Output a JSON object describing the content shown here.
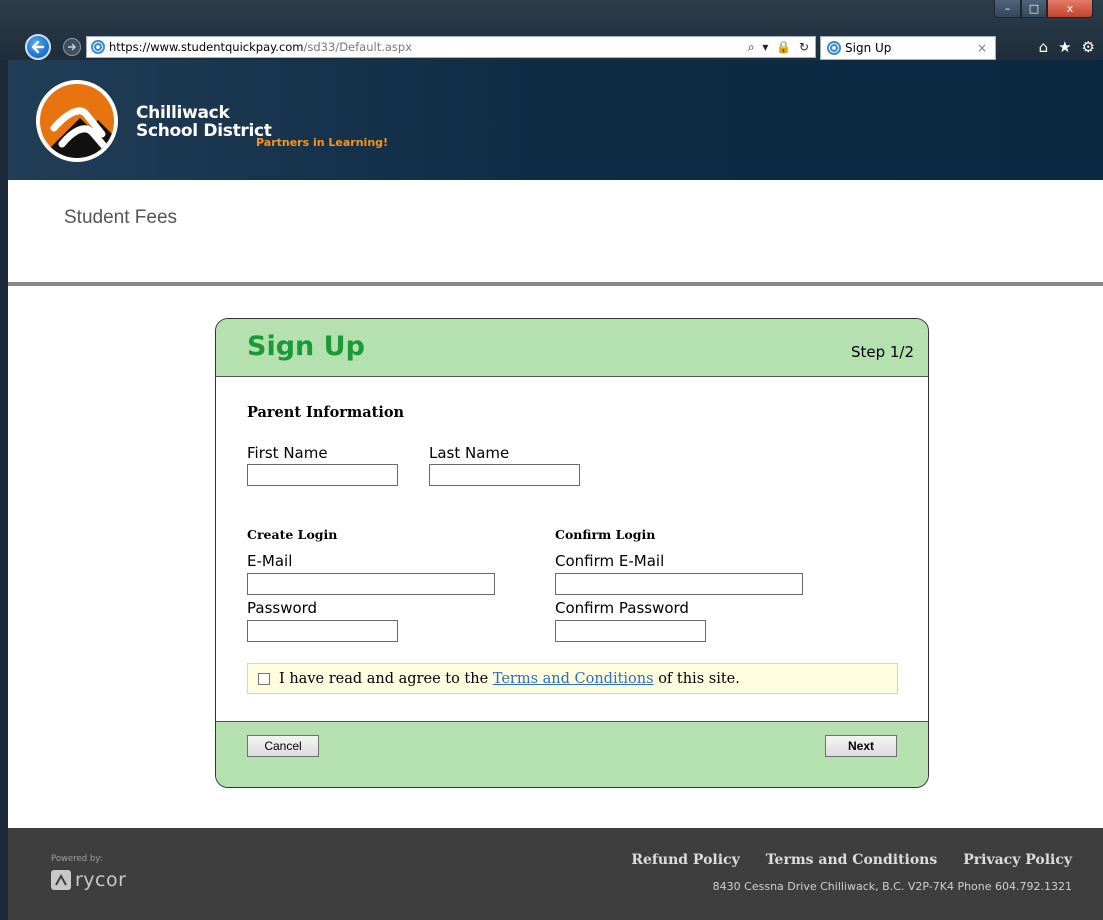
{
  "browser": {
    "url_scheme": "https://",
    "url_host": "www.studentquickpay.com",
    "url_path": "/sd33/Default.aspx",
    "tab_title": "Sign Up",
    "window_controls": {
      "minimize": "–",
      "maximize": "□",
      "close": "x"
    },
    "addr_tools": "⌕ ▾ 🔒 ↻",
    "tab_close": "×",
    "icons": {
      "home": "⌂",
      "favorites": "★",
      "settings": "⚙"
    }
  },
  "header": {
    "logo_line1": "Chilliwack",
    "logo_line2": "School District",
    "tagline": "Partners in Learning!",
    "brand_color": "#e8740f"
  },
  "page": {
    "title": "Student Fees"
  },
  "signup": {
    "title": "Sign Up",
    "step": "Step 1/2",
    "parent_info_heading": "Parent Information",
    "first_name_label": "First Name",
    "first_name_value": "",
    "last_name_label": "Last Name",
    "last_name_value": "",
    "create_login_heading": "Create Login",
    "confirm_login_heading": "Confirm Login",
    "email_label": "E-Mail",
    "email_value": "",
    "confirm_email_label": "Confirm E-Mail",
    "confirm_email_value": "",
    "password_label": "Password",
    "confirm_password_label": "Confirm Password",
    "terms_prefix": "I have read and agree to the",
    "terms_link": "Terms and Conditions",
    "terms_suffix": "of this site.",
    "terms_checked": false,
    "cancel_label": "Cancel",
    "next_label": "Next",
    "accent_color": "#1a9a36",
    "panel_color": "#b5e0b0"
  },
  "footer": {
    "powered_by": "Powered by:",
    "brand": "rycor",
    "links": [
      "Refund Policy",
      "Terms and Conditions",
      "Privacy Policy"
    ],
    "address": "8430 Cessna Drive Chilliwack, B.C. V2P-7K4 Phone 604.792.1321"
  }
}
